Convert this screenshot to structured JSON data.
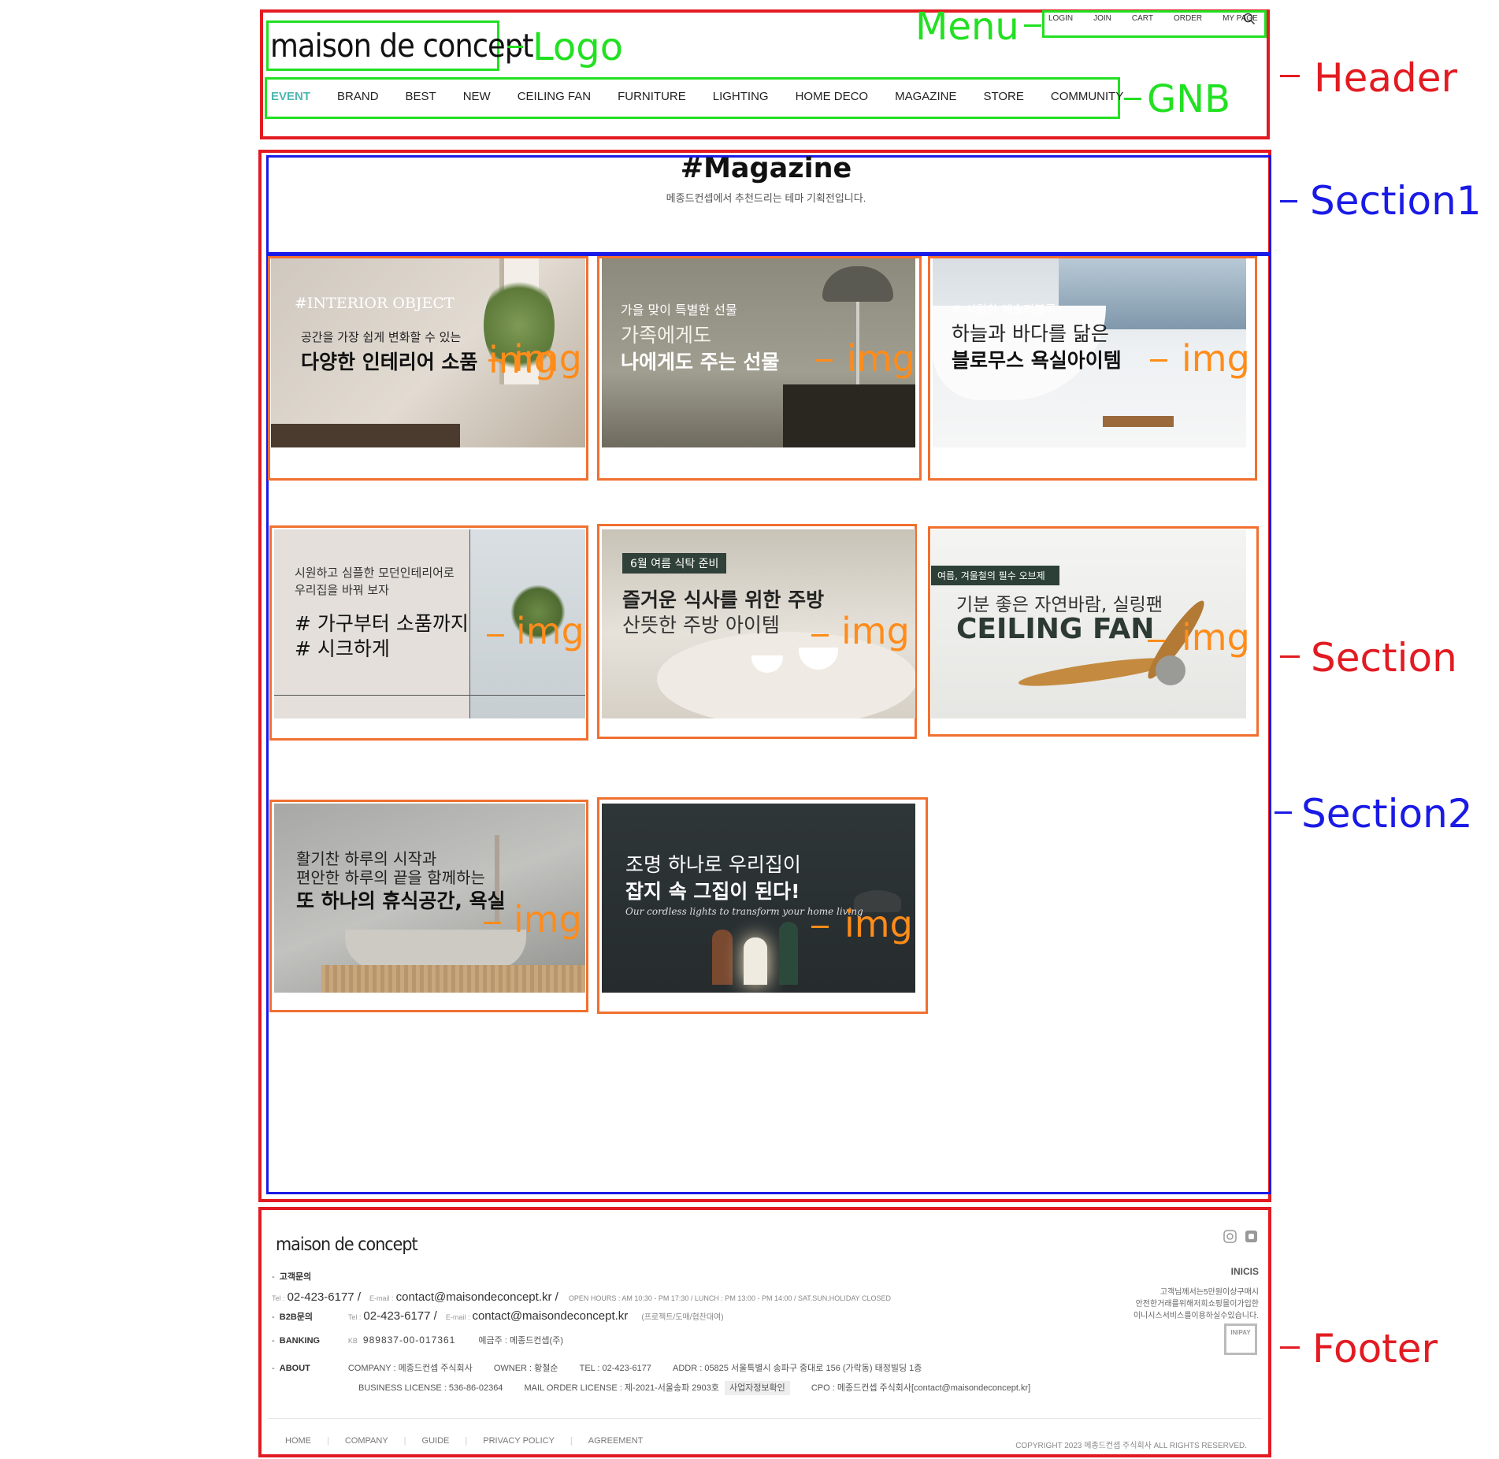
{
  "header": {
    "logo": "maison de concept",
    "menu": [
      "LOGIN",
      "JOIN",
      "CART",
      "ORDER",
      "MY PAGE"
    ],
    "gnb": [
      "EVENT",
      "BRAND",
      "BEST",
      "NEW",
      "CEILING FAN",
      "FURNITURE",
      "LIGHTING",
      "HOME DECO",
      "MAGAZINE",
      "STORE",
      "COMMUNITY"
    ],
    "active_color": "#4db8b0"
  },
  "annotations": {
    "logo": "Logo",
    "menu": "Menu",
    "gnb": "GNB",
    "header": "Header",
    "section1": "Section1",
    "section": "Section",
    "section2": "Section2",
    "footer": "Footer",
    "img": "img"
  },
  "section1": {
    "title": "#Magazine",
    "subtitle": "메종드컨셉에서 추천드리는 테마 기획전입니다."
  },
  "cards": [
    {
      "tag": "#INTERIOR OBJECT",
      "line1": "공간을 가장 쉽게 변화할 수 있는",
      "line2": "다양한 인테리어 소품"
    },
    {
      "tag": "가을 맞이 특별한 선물",
      "line1": "가족에게도",
      "line2": "나에게도 주는 선물"
    },
    {
      "tag": "# 시원한 애슐리블루",
      "line1": "하늘과 바다를 닮은",
      "line2": "블로무스 욕실아이템"
    },
    {
      "tag": "시원하고 심플한 모던인테리어로",
      "tag2": "우리집을 바꿔 보자",
      "line1": "# 가구부터 소품까지",
      "line2": "# 시크하게"
    },
    {
      "tag": "6월 여름 식탁 준비",
      "line1": "즐거운 식사를 위한 주방",
      "line2": "산뜻한 주방 아이템"
    },
    {
      "tag": "여름, 겨울철의 필수 오브제",
      "line1": "기분 좋은 자연바람, 실링팬",
      "line2": "CEILING FAN"
    },
    {
      "tag": "활기찬 하루의 시작과",
      "line1": "편안한 하루의 끝을 함께하는",
      "line2": "또 하나의 휴식공간, 욕실"
    },
    {
      "tag": "조명 하나로 우리집이",
      "line1": "잡지 속 그집이 된다!",
      "line2": "Our cordless lights to transform your home living"
    }
  ],
  "footer": {
    "logo": "maison de concept",
    "cs_label": "고객문의",
    "tel_label": "Tel :",
    "tel": "02-423-6177 /",
    "email_label": "E-mail :",
    "email": "contact@maisondeconcept.kr /",
    "hours": "OPEN HOURS : AM 10:30 - PM 17:30 / LUNCH : PM 13:00 - PM 14:00 / SAT.SUN.HOLIDAY CLOSED",
    "b2b_label": "B2B문의",
    "b2b_tel": "02-423-6177 /",
    "b2b_email": "contact@maisondeconcept.kr",
    "b2b_note": "(프로젝트/도매/협찬대여)",
    "banking_label": "BANKING",
    "bank": "KB",
    "account": "989837-00-017361",
    "depositor": "예금주 : 메종드컨셉(주)",
    "about_label": "ABOUT",
    "company": "COMPANY : 메종드컨셉 주식회사",
    "owner": "OWNER : 황철순",
    "tel2": "TEL : 02-423-6177",
    "addr": "ADDR : 05825 서울특별시 송파구 중대로 156 (가락동) 태정빌딩 1층",
    "license": "BUSINESS LICENSE : 536-86-02364",
    "mail_order": "MAIL ORDER LICENSE : 제-2021-서울송파 2903호",
    "biz_check": "사업자정보확인",
    "cpo": "CPO : 메종드컨셉 주식회사[contact@maisondeconcept.kr]",
    "inicis": "INICIS",
    "inicis_text1": "고객님께서는5만원이상구매시",
    "inicis_text2": "안전한거래를위해저희쇼핑몰이가입한",
    "inicis_text3": "이니시스서비스를이용하실수있습니다.",
    "inipay": "INIPAY",
    "links": [
      "HOME",
      "COMPANY",
      "GUIDE",
      "PRIVACY POLICY",
      "AGREEMENT"
    ],
    "copyright": "COPYRIGHT 2023 메종드컨셉 주식회사 ALL RIGHTS RESERVED."
  }
}
